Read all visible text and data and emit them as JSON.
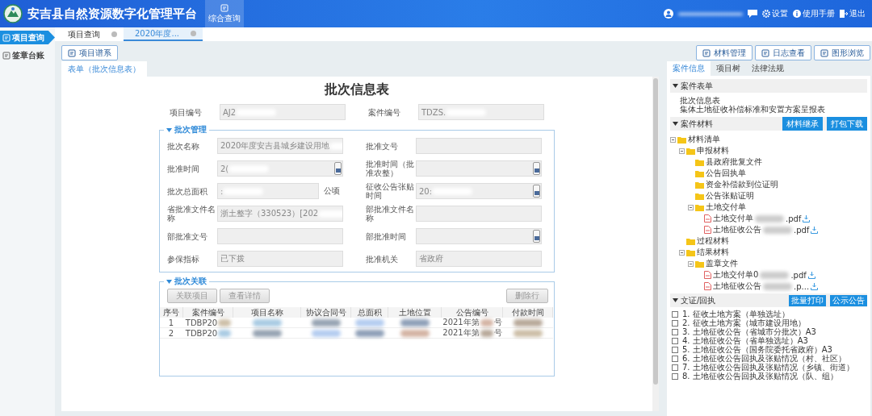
{
  "header": {
    "title": "安吉县自然资源数字化管理平台",
    "nav": [
      {
        "label": "综合查询",
        "selected": true
      }
    ],
    "user": {
      "redacted": true
    },
    "actions": [
      {
        "kind": "message"
      },
      {
        "kind": "settings",
        "label": "设置"
      },
      {
        "kind": "info",
        "label": "使用手册"
      },
      {
        "kind": "exit",
        "label": "退出"
      }
    ]
  },
  "sidebar": {
    "items": [
      {
        "label": "项目查询",
        "selected": true
      },
      {
        "label": "签章台账",
        "selected": false
      }
    ]
  },
  "tabs": [
    {
      "label": "项目查询",
      "selected": false
    },
    {
      "label": "2020年度...",
      "selected": true
    }
  ],
  "toolbar": {
    "left": [
      {
        "label": "项目谱系"
      }
    ],
    "right": [
      {
        "label": "材料管理"
      },
      {
        "label": "日志查看"
      },
      {
        "label": "图形浏览"
      }
    ]
  },
  "form_tab": {
    "label": "表单（批次信息表）",
    "selected": true
  },
  "form": {
    "title": "批次信息表",
    "top_fields": [
      {
        "label": "项目编号",
        "value": "AJ2",
        "kind": "text",
        "redacted": true
      },
      {
        "label": "案件编号",
        "value": "TDZS.",
        "kind": "text",
        "redacted": true
      }
    ],
    "sections": [
      {
        "legend": "批次管理",
        "expanded": true,
        "fields": [
          {
            "label": "批次名称",
            "value": "2020年度安吉县城乡建设用地",
            "kind": "text",
            "redacted": true
          },
          {
            "label": "批准文号",
            "kind": "text"
          },
          {
            "label": "批准时间",
            "value": "2(",
            "kind": "date",
            "redacted": true
          },
          {
            "label": "批准时间（批准农整）",
            "kind": "date"
          },
          {
            "label": "批次总面积",
            "value": ":",
            "kind": "text",
            "unit": "公顷",
            "redacted": true
          },
          {
            "label": "征收公告张贴时间",
            "value": "20:",
            "kind": "date",
            "redacted": true
          },
          {
            "label": "省批准文件名称",
            "value": "浙土整字（330523）[202",
            "kind": "text",
            "redacted": true
          },
          {
            "label": "部批准文件名称",
            "kind": "text"
          },
          {
            "label": "部批准文号",
            "kind": "text"
          },
          {
            "label": "部批准时间",
            "kind": "date"
          },
          {
            "label": "参保指标",
            "value": "已下拨",
            "kind": "text"
          },
          {
            "label": "批准机关",
            "value": "省政府",
            "kind": "text"
          }
        ]
      }
    ],
    "relation": {
      "legend": "批次关联",
      "expanded": true,
      "buttons": [
        "关联项目",
        "查看详情"
      ],
      "delete_button": "删除行",
      "columns": [
        "序号",
        "案件编号",
        "项目名称",
        "协议合同号",
        "总面积",
        "土地位置",
        "公告编号",
        "付款时间"
      ],
      "rows": [
        {
          "cells": [
            {
              "text": "1"
            },
            {
              "text": "TDBP20",
              "redacted": true
            },
            {
              "redacted": true
            },
            {
              "redacted": true
            },
            {
              "redacted": true
            },
            {
              "redacted": true
            },
            {
              "text": "2021年第",
              "suffix": "号",
              "redacted": true
            },
            {
              "redacted": true
            }
          ]
        },
        {
          "cells": [
            {
              "text": "2"
            },
            {
              "text": "TDBP20",
              "redacted": true
            },
            {
              "redacted": true
            },
            {
              "redacted": true
            },
            {
              "redacted": true
            },
            {
              "redacted": true
            },
            {
              "text": "2021年第",
              "suffix": "号",
              "redacted": true
            },
            {
              "redacted": true
            }
          ]
        }
      ]
    }
  },
  "right_panel": {
    "tabs": [
      {
        "label": "案件信息",
        "selected": true
      },
      {
        "label": "项目树",
        "selected": false
      },
      {
        "label": "法律法规",
        "selected": false
      }
    ],
    "form_list": {
      "title": "案件表单",
      "expanded": true,
      "items": [
        "批次信息表",
        "集体土地征收补偿标准和安置方案呈报表"
      ]
    },
    "materials": {
      "title": "案件材料",
      "expanded": true,
      "buttons": [
        "材料继承",
        "打包下载"
      ],
      "tree": [
        {
          "label": "材料清单",
          "kind": "folder",
          "expanded": true,
          "children": [
            {
              "label": "申报材料",
              "kind": "folder",
              "expanded": true,
              "children": [
                {
                  "label": "县政府批复文件",
                  "kind": "folder"
                },
                {
                  "label": "公告回执单",
                  "kind": "folder"
                },
                {
                  "label": "资金补偿款到位证明",
                  "kind": "folder"
                },
                {
                  "label": "公告张贴证明",
                  "kind": "folder"
                },
                {
                  "label": "土地交付单",
                  "kind": "folder",
                  "expanded": true,
                  "children": [
                    {
                      "label": "土地交付单",
                      "suffix": ".pdf",
                      "kind": "file",
                      "redacted": true
                    },
                    {
                      "label": "土地征收公告",
                      "suffix": ".pdf",
                      "kind": "file",
                      "redacted": true
                    }
                  ]
                }
              ]
            },
            {
              "label": "过程材料",
              "kind": "folder"
            },
            {
              "label": "结果材料",
              "kind": "folder",
              "expanded": true,
              "children": [
                {
                  "label": "盖章文件",
                  "kind": "folder",
                  "expanded": true,
                  "children": [
                    {
                      "label": "土地交付单0",
                      "suffix": ".pdf",
                      "kind": "file",
                      "redacted": true
                    },
                    {
                      "label": "土地征收公告",
                      "suffix": ".p...",
                      "kind": "file",
                      "redacted": true
                    }
                  ]
                }
              ]
            }
          ]
        }
      ]
    },
    "receipts": {
      "title": "文证/回执",
      "expanded": true,
      "buttons": [
        "批量打印",
        "公示公告"
      ],
      "items": [
        {
          "label": "1. 征收土地方案（单独选址）",
          "checked": false
        },
        {
          "label": "2. 征收土地方案（城市建设用地）",
          "checked": false
        },
        {
          "label": "3. 土地征收公告（省城市分批次）A3",
          "checked": false
        },
        {
          "label": "4. 土地征收公告（省单独选址）A3",
          "checked": false
        },
        {
          "label": "5. 土地征收公告（国务院委托省政府）A3",
          "checked": false
        },
        {
          "label": "6. 土地征收公告回执及张贴情况（村、社区）",
          "checked": false
        },
        {
          "label": "7. 土地征收公告回执及张贴情况（乡镇、街道）",
          "checked": false
        },
        {
          "label": "8. 土地征收公告回执及张贴情况（队、组）",
          "checked": false
        }
      ]
    }
  }
}
